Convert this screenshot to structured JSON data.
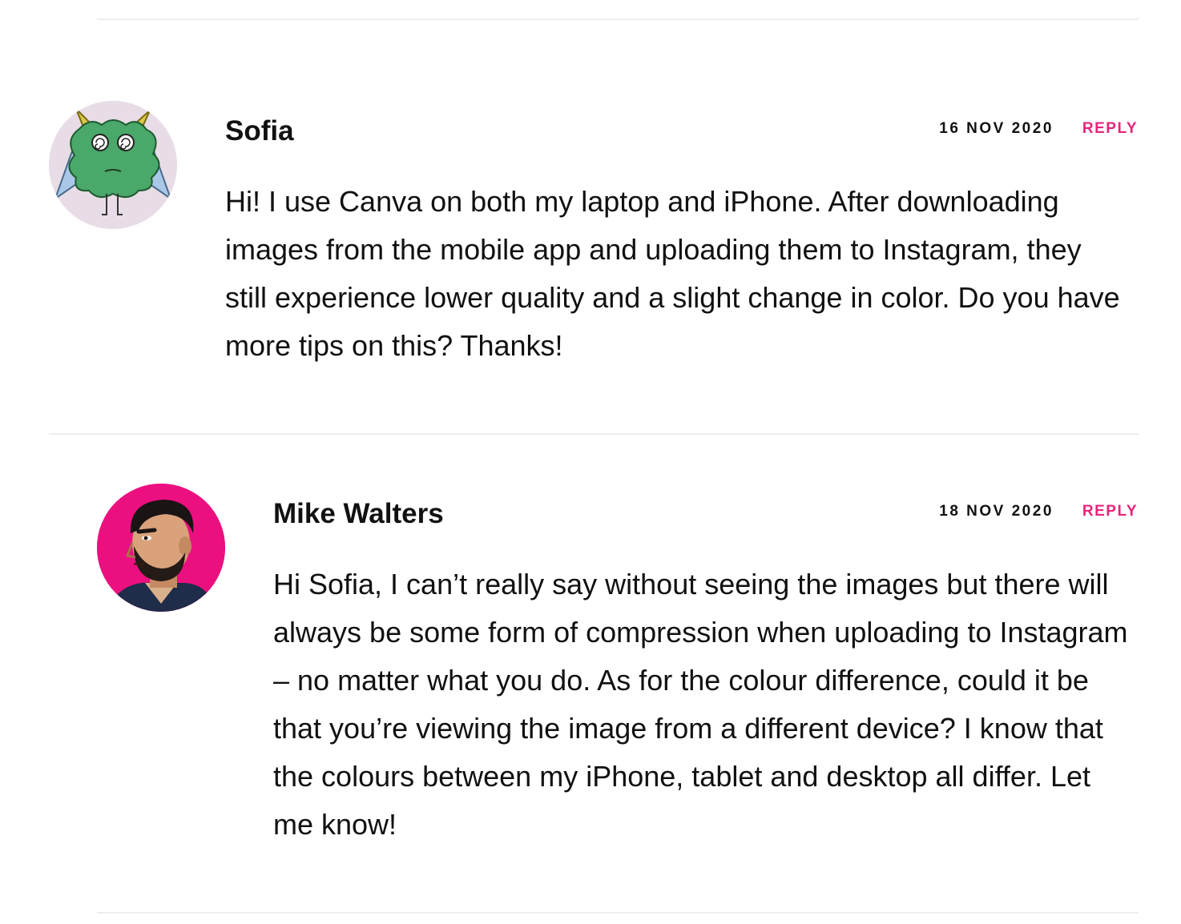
{
  "comments": [
    {
      "author": "Sofia",
      "date": "16 NOV 2020",
      "reply_label": "REPLY",
      "avatar_icon": "green-monster-avatar",
      "text": "Hi! I use Canva on both my laptop and iPhone. After downloading images from the mobile app and uploading them to Instagram, they still experience lower quality and a slight change in color. Do you have more tips on this? Thanks!"
    },
    {
      "author": "Mike Walters",
      "date": "18 NOV 2020",
      "reply_label": "REPLY",
      "avatar_icon": "illustrated-man-avatar",
      "text": "Hi Sofia, I can’t really say without seeing the images but there will always be some form of compression when uploading to Instagram – no matter what you do. As for the colour difference, could it be that you’re viewing the image from a different device? I know that the colours between my iPhone, tablet and desktop all differ. Let me know!"
    }
  ],
  "colors": {
    "accent": "#e8247b",
    "divider": "#eeeeee",
    "text": "#111111"
  }
}
